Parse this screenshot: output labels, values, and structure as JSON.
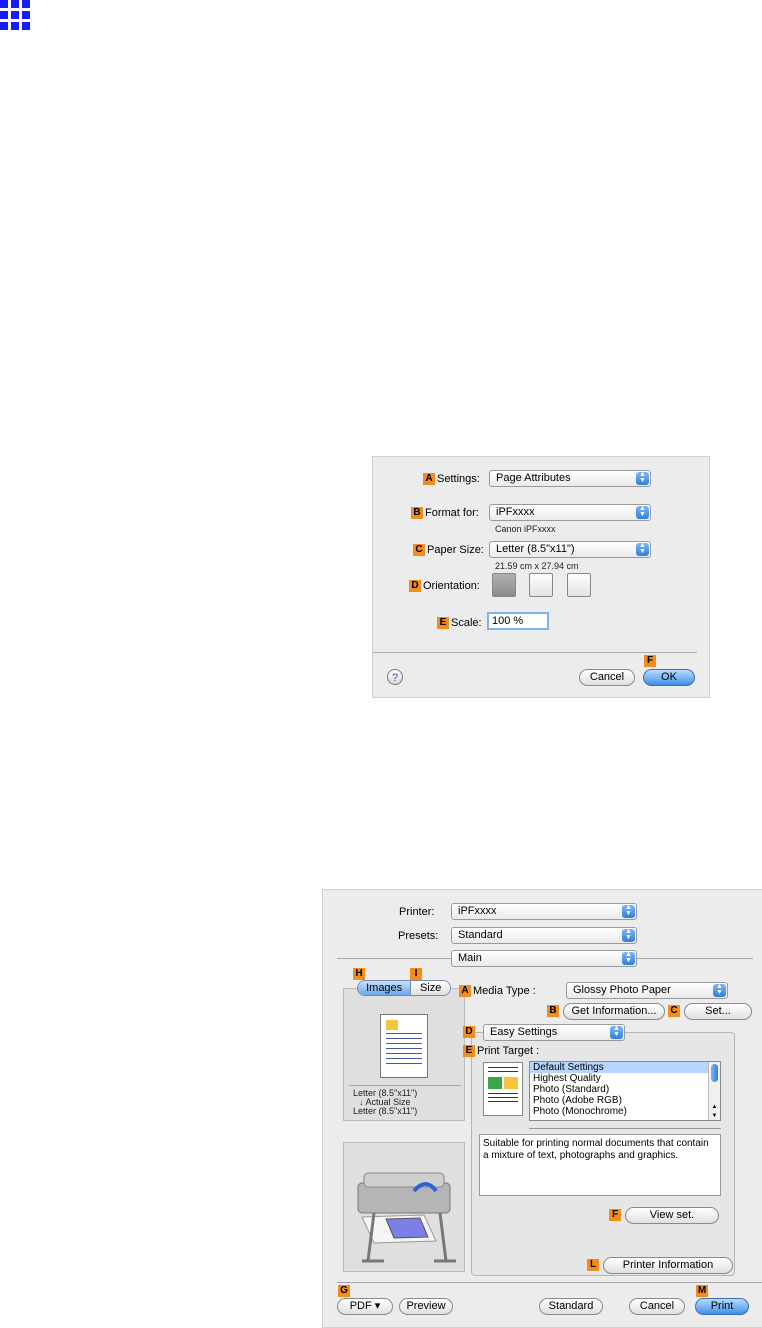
{
  "page_setup": {
    "settings_label": "Settings:",
    "settings_value": "Page Attributes",
    "format_label": "Format for:",
    "format_value": "iPFxxxx",
    "format_sub": "Canon iPFxxxx",
    "paper_label": "Paper Size:",
    "paper_value": "Letter (8.5\"x11\")",
    "paper_sub": "21.59 cm x 27.94 cm",
    "orientation_label": "Orientation:",
    "scale_label": "Scale:",
    "scale_value": "100 %",
    "help": "?",
    "cancel": "Cancel",
    "ok": "OK",
    "badges": {
      "a": "A",
      "b": "B",
      "c": "C",
      "d": "D",
      "e": "E",
      "f": "F"
    }
  },
  "print_dialog": {
    "printer_label": "Printer:",
    "printer_value": "iPFxxxx",
    "presets_label": "Presets:",
    "presets_value": "Standard",
    "pane_value": "Main",
    "tabs": {
      "images": "Images",
      "size": "Size"
    },
    "preview_text": [
      "Letter (8.5\"x11\")",
      "Actual Size",
      "Letter (8.5\"x11\")"
    ],
    "media_type_label": "Media Type :",
    "media_type_value": "Glossy Photo Paper",
    "get_info": "Get Information...",
    "set": "Set...",
    "easy_settings": "Easy Settings",
    "print_target_label": "Print Target :",
    "print_targets": [
      "Default Settings",
      "Highest Quality",
      "Photo (Standard)",
      "Photo (Adobe RGB)",
      "Photo (Monochrome)"
    ],
    "description": "Suitable for printing normal documents that contain a mixture of text, photographs and graphics.",
    "view_set": "View set.",
    "printer_info": "Printer Information",
    "pdf": "PDF ▾",
    "preview": "Preview",
    "standard": "Standard",
    "cancel": "Cancel",
    "print": "Print",
    "badges": {
      "h": "H",
      "i": "I",
      "a": "A",
      "b": "B",
      "c": "C",
      "d": "D",
      "e": "E",
      "f": "F",
      "l": "L",
      "g": "G",
      "m": "M"
    }
  }
}
